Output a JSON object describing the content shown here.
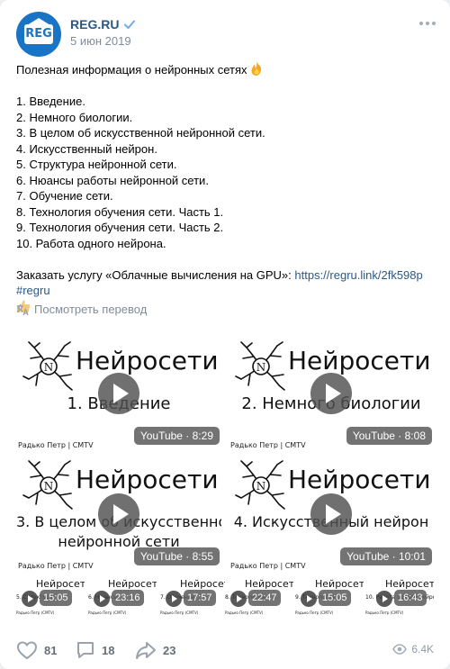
{
  "header": {
    "author": "REG.RU",
    "date": "5 июн 2019",
    "avatar_text": "REG"
  },
  "post": {
    "title": "Полезная информация о нейронных сетях",
    "title_emoji": "fire-icon",
    "items": [
      "1. Введение.",
      "2. Немного биологии.",
      "3. В целом об искусственной нейронной сети.",
      "4. Искусственный нейрон.",
      "5. Структура нейронной сети.",
      "6. Нюансы работы нейронной сети.",
      "7. Обучение сети.",
      "8. Технология обучения сети. Часть 1.",
      "9. Технология обучения сети. Часть 2.",
      "10. Работа одного нейрона."
    ],
    "order_text": "Заказать услугу «Облачные вычисления на GPU»: ",
    "order_link": "https://regru.link/2fk598p",
    "hashtag": "#regru",
    "order_emoji": "thumbs-up-icon",
    "translate_label": "Посмотреть перевод"
  },
  "videos": {
    "brand": "Нейросети",
    "author": "Радько Петр | CMTV",
    "large": [
      {
        "title": "1. Введение",
        "badge": "YouTube · 8:29"
      },
      {
        "title": "2. Немного биологии",
        "badge": "YouTube · 8:08"
      },
      {
        "title": "3. В целом об искусственной",
        "title2": "нейронной сети",
        "badge": "YouTube · 8:55"
      },
      {
        "title": "4. Искусственный нейрон",
        "badge": "YouTube · 10:01"
      }
    ],
    "small": [
      {
        "title": "5. Структура",
        "duration": "15:05"
      },
      {
        "title": "6. Нюансы",
        "duration": "23:16"
      },
      {
        "title": "7. Обучение",
        "duration": "17:57"
      },
      {
        "title": "8. Технология",
        "duration": "22:47"
      },
      {
        "title": "9. Технология",
        "duration": "15:05"
      },
      {
        "title": "10. Работа одного нейрона",
        "duration": "16:43"
      }
    ],
    "small_author": "Радько Петр (CMTV)"
  },
  "footer": {
    "likes": "81",
    "comments": "18",
    "shares": "23",
    "views": "6.4K"
  },
  "colors": {
    "link": "#2a5885",
    "secondary": "#818c99",
    "brand_blue": "#1a74c6"
  }
}
